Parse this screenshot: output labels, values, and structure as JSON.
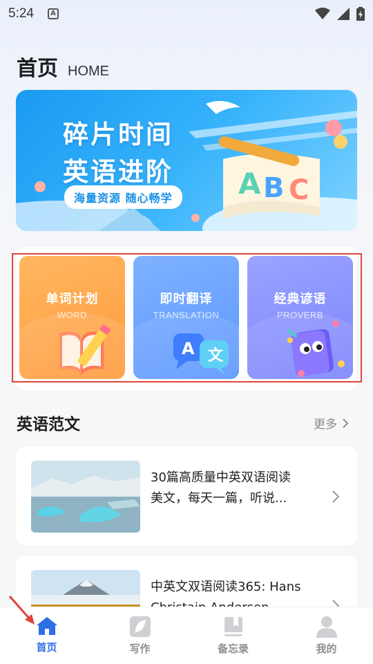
{
  "status_bar": {
    "time": "5:24",
    "notif_icon": "A"
  },
  "header": {
    "title": "首页",
    "subtitle": "HOME"
  },
  "banner": {
    "line1": "碎片时间",
    "line2": "英语进阶",
    "tagline": "海量资源  随心畅学"
  },
  "features": [
    {
      "title": "单词计划",
      "subtitle": "WORD",
      "color": "#ff9a3c",
      "icon": "book-pencil-icon"
    },
    {
      "title": "即时翻译",
      "subtitle": "TRANSLATION",
      "color": "#5c96ff",
      "icon": "translate-bubbles-icon"
    },
    {
      "title": "经典谚语",
      "subtitle": "PROVERB",
      "color": "#7b84fb",
      "icon": "cute-book-icon"
    }
  ],
  "section": {
    "title": "英语范文",
    "more": "更多"
  },
  "articles": [
    {
      "title_line1": "30篇高质量中英双语阅读",
      "title_line2": "美文，每天一篇，听说..."
    },
    {
      "title_line1": "中英文双语阅读365: Hans",
      "title_line2": "Christain Andersen"
    }
  ],
  "tabs": [
    {
      "label": "首页",
      "icon": "home-icon",
      "active": true
    },
    {
      "label": "写作",
      "icon": "feather-icon",
      "active": false
    },
    {
      "label": "备忘录",
      "icon": "bookmark-book-icon",
      "active": false
    },
    {
      "label": "我的",
      "icon": "person-icon",
      "active": false
    }
  ],
  "colors": {
    "accent": "#2f6fe6",
    "annotation": "#e0453a"
  }
}
